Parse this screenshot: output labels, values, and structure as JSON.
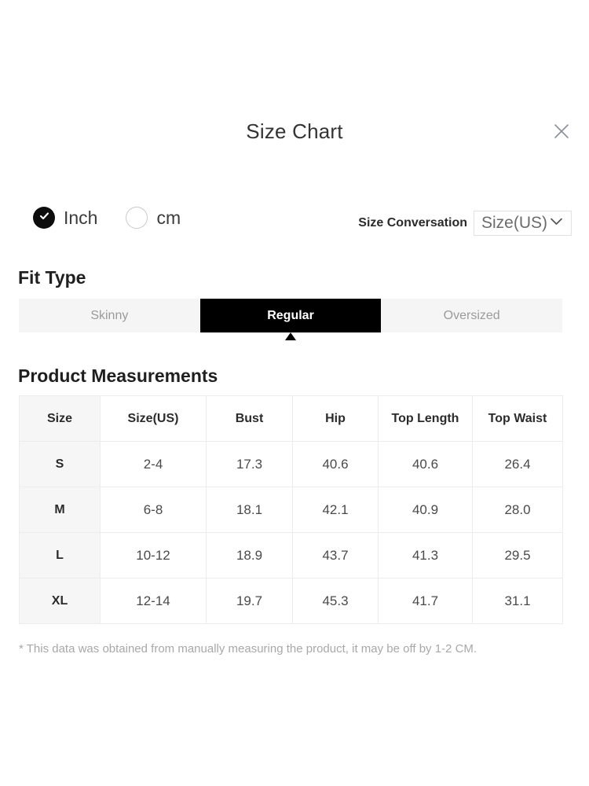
{
  "modal": {
    "title": "Size Chart",
    "close_icon": "close-icon"
  },
  "units": {
    "selected": "Inch",
    "options": [
      {
        "label": "Inch",
        "checked": true
      },
      {
        "label": "cm",
        "checked": false
      }
    ]
  },
  "size_conversation": {
    "label": "Size Conversation",
    "selected": "Size(US)",
    "chevron_icon": "chevron-down-icon"
  },
  "fit_type": {
    "heading": "Fit Type",
    "tabs": [
      {
        "label": "Skinny",
        "active": false
      },
      {
        "label": "Regular",
        "active": true
      },
      {
        "label": "Oversized",
        "active": false
      }
    ]
  },
  "measurements": {
    "heading": "Product Measurements",
    "columns": [
      "Size",
      "Size(US)",
      "Bust",
      "Hip",
      "Top Length",
      "Top Waist"
    ],
    "rows": [
      [
        "S",
        "2-4",
        "17.3",
        "40.6",
        "40.6",
        "26.4"
      ],
      [
        "M",
        "6-8",
        "18.1",
        "42.1",
        "40.9",
        "28.0"
      ],
      [
        "L",
        "10-12",
        "18.9",
        "43.7",
        "41.3",
        "29.5"
      ],
      [
        "XL",
        "12-14",
        "19.7",
        "45.3",
        "41.7",
        "31.1"
      ]
    ]
  },
  "footnote": "* This data was obtained from manually measuring the product, it may be off by 1-2 CM.",
  "colors": {
    "accent": "#000000",
    "tab_bar_bg": "#f5f5f5",
    "table_border": "#ececec",
    "size_col_bg": "#f6f6f6",
    "muted_text": "#9b9b9b",
    "footnote_text": "#a8a8a8"
  }
}
